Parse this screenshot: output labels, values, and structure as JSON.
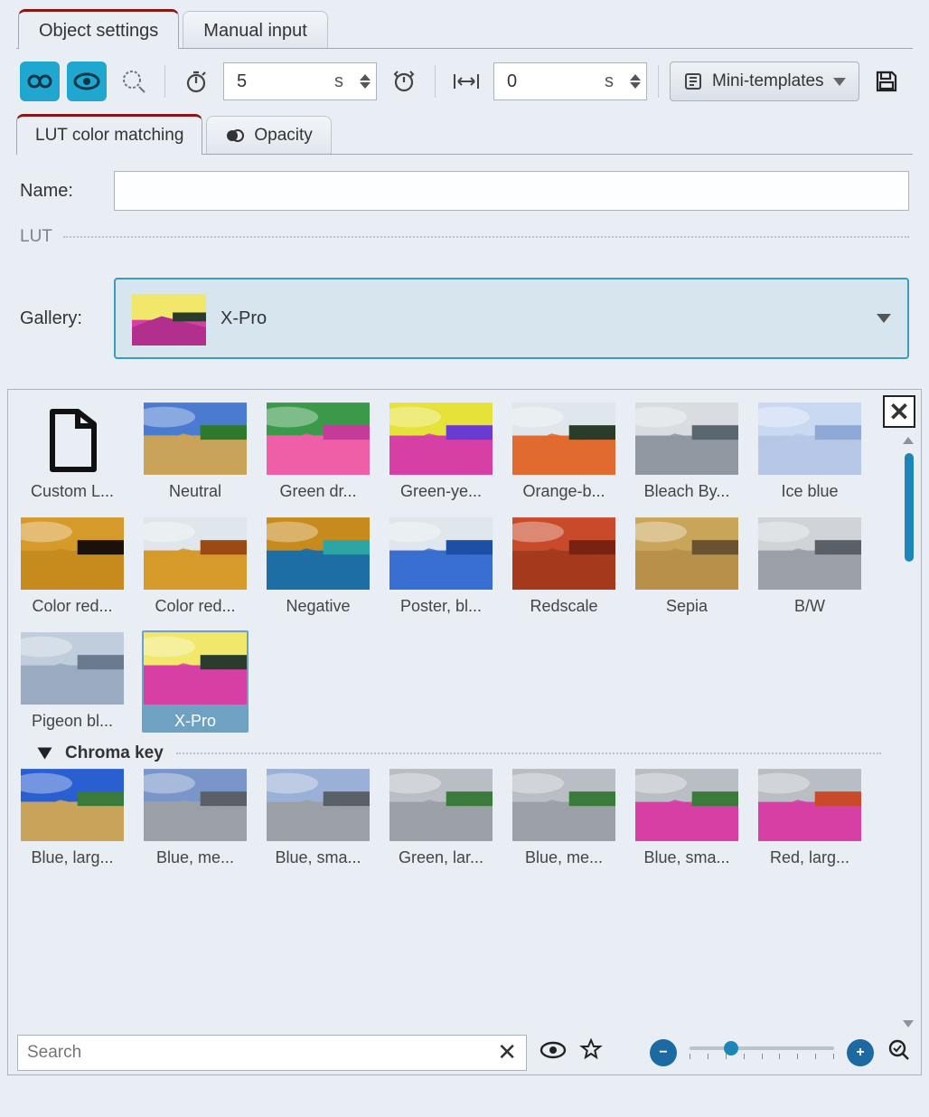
{
  "top_tabs": {
    "object_settings": "Object settings",
    "manual_input": "Manual input"
  },
  "toolbar": {
    "duration_value": "5",
    "duration_unit": "s",
    "offset_value": "0",
    "offset_unit": "s",
    "mini_templates": "Mini-templates"
  },
  "sub_tabs": {
    "lut": "LUT color matching",
    "opacity": "Opacity"
  },
  "form": {
    "name_label": "Name:",
    "name_value": "",
    "lut_section": "LUT",
    "gallery_label": "Gallery:",
    "gallery_value": "X-Pro"
  },
  "gallery": {
    "group1": [
      {
        "id": "custom",
        "label": "Custom L..."
      },
      {
        "id": "neutral",
        "label": "Neutral"
      },
      {
        "id": "greendr",
        "label": "Green dr..."
      },
      {
        "id": "greenye",
        "label": "Green-ye..."
      },
      {
        "id": "orangeb",
        "label": "Orange-b..."
      },
      {
        "id": "bleach",
        "label": "Bleach By..."
      },
      {
        "id": "iceblue",
        "label": "Ice blue"
      },
      {
        "id": "colorred1",
        "label": "Color red..."
      },
      {
        "id": "colorred2",
        "label": "Color red..."
      },
      {
        "id": "negative",
        "label": "Negative"
      },
      {
        "id": "posterbl",
        "label": "Poster, bl..."
      },
      {
        "id": "redscale",
        "label": "Redscale"
      },
      {
        "id": "sepia",
        "label": "Sepia"
      },
      {
        "id": "bw",
        "label": "B/W"
      },
      {
        "id": "pigeon",
        "label": "Pigeon bl..."
      },
      {
        "id": "xpro",
        "label": "X-Pro"
      }
    ],
    "chroma_header": "Chroma key",
    "group2": [
      {
        "id": "bluelarge",
        "label": "Blue, larg..."
      },
      {
        "id": "bluemed1",
        "label": "Blue, me..."
      },
      {
        "id": "bluesma1",
        "label": "Blue, sma..."
      },
      {
        "id": "greenlar",
        "label": "Green, lar..."
      },
      {
        "id": "bluemed2",
        "label": "Blue, me..."
      },
      {
        "id": "bluesma2",
        "label": "Blue, sma..."
      },
      {
        "id": "redlarge",
        "label": "Red, larg..."
      }
    ],
    "selected_id": "xpro"
  },
  "bottom": {
    "search_placeholder": "Search"
  }
}
